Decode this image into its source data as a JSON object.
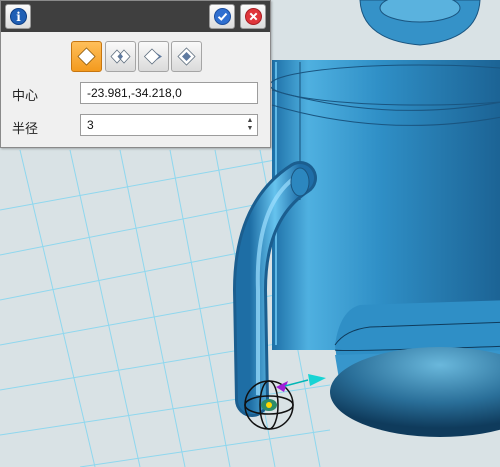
{
  "panel": {
    "mode_buttons": [
      {
        "name": "single-side",
        "active": true
      },
      {
        "name": "double-side",
        "active": false
      },
      {
        "name": "side-right",
        "active": false
      },
      {
        "name": "side-inner",
        "active": false
      }
    ],
    "center": {
      "label": "中心",
      "value": "-23.981,-34.218,0"
    },
    "radius": {
      "label": "半径",
      "value": "3"
    }
  },
  "icons": {
    "info": "info-icon",
    "confirm": "checkmark-icon",
    "close": "close-x-icon",
    "spinner": "spin-arrows-icon"
  },
  "colors": {
    "model_blue": "#2d8dc4",
    "grid_background": "#d9e2e5",
    "grid_line": "#8fd7ee",
    "title_bar": "#3f3f3f",
    "active_button": "#f39a1e"
  }
}
